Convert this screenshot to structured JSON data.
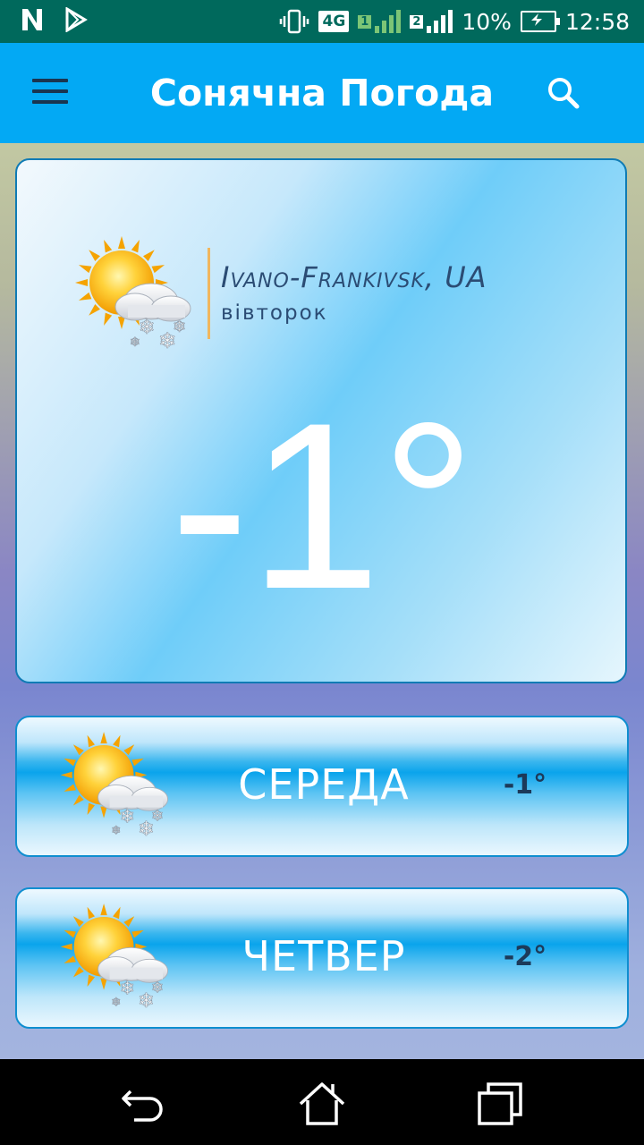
{
  "status_bar": {
    "time": "12:58",
    "battery": "10%",
    "network": "4G",
    "sim1": "1",
    "sim2": "2",
    "icons": [
      "n-notification-icon",
      "play-store-icon",
      "vibrate-icon",
      "signal-icon",
      "battery-charging-icon"
    ]
  },
  "app_bar": {
    "title": "Сонячна Погода",
    "menu_icon": "hamburger-menu-icon",
    "search_icon": "search-icon",
    "color": "#03a9f4"
  },
  "current": {
    "city": "Ivano-Frankivsk, UA",
    "weekday": "вівторок",
    "temperature": "-1°",
    "icon": "partly-cloudy-snow-icon"
  },
  "forecast": [
    {
      "day": "СЕРЕДА",
      "temp": "-1°",
      "icon": "partly-cloudy-snow-icon"
    },
    {
      "day": "ЧЕТВЕР",
      "temp": "-2°",
      "icon": "partly-cloudy-snow-icon"
    }
  ],
  "nav_bar": {
    "icons": [
      "back-icon",
      "home-icon",
      "recents-icon"
    ]
  }
}
